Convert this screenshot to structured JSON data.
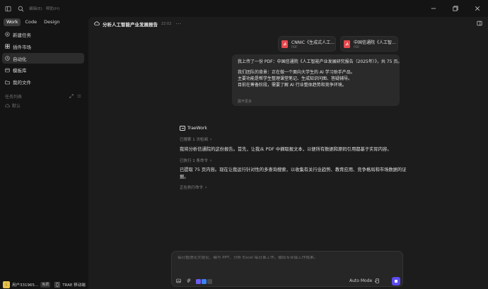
{
  "window": {
    "menu": [
      "编辑(E)",
      "帮助(H)"
    ]
  },
  "sidebar": {
    "tabs": [
      {
        "label": "Work",
        "active": true
      },
      {
        "label": "Code",
        "active": false
      },
      {
        "label": "Design",
        "active": false
      }
    ],
    "nav": [
      {
        "label": "新建任务",
        "icon": "new-task-icon",
        "active": false
      },
      {
        "label": "插件市场",
        "icon": "plugin-market-icon",
        "active": false
      },
      {
        "label": "自动化",
        "icon": "automation-icon",
        "active": true
      },
      {
        "label": "模板库",
        "icon": "template-icon",
        "active": false
      },
      {
        "label": "我的文件",
        "icon": "folder-icon",
        "active": false
      }
    ],
    "task_list": {
      "title": "任务列表",
      "item": "默认"
    },
    "user": {
      "avatar": "i",
      "name": "用户331965...",
      "plan": "免费",
      "remote_label": "TRAE 移动端"
    }
  },
  "conversation": {
    "title": "分析人工智能产业发展报告",
    "time": "22:02",
    "more": "···"
  },
  "attachments": [
    {
      "name": "CNNIC《生成式人工智能应用发展报告》",
      "type": "PDF"
    },
    {
      "name": "中国信通院《人工智能产业发展研究报告》",
      "type": "PDF"
    }
  ],
  "user_message": {
    "lines": [
      "我上传了一份 PDF：中国信通院《人工智能产业发展研究报告（2025年）》，共 75 页。",
      "",
      "我们团队的背景：正在做一个面向大学生的 AI 学习助手产品。",
      "主要功能是帮学生整理课堂笔记、生成知识问图、答疑辅导。",
      "目前在筹备阶段，需要了解 AI 行业整体趋势和竞争环境。"
    ],
    "expand_label": "展开更多"
  },
  "assistant": {
    "brand": "TraeWork",
    "step1": "已搜索 1 次检阅",
    "para1": "我将分析信通院的这份报告。首先，让我从 PDF 中摘取报文本，以便所有数据和原码引用都基于实际内容。",
    "step2": "已执行 1 条命令",
    "para2_line1": "已提取 75 页内容。现在让我运行针对性的多查询搜索，以收集有关行业趋势、教育应用、竞争格局和市场数据的证",
    "para2_line2": "据。",
    "step3": "正在执行命令"
  },
  "composer": {
    "placeholder": "每日整理论文结论、编写 PPT、分析 Excel 每日事工作，输出专业级工作成果。",
    "mode": "Auto Mode"
  }
}
